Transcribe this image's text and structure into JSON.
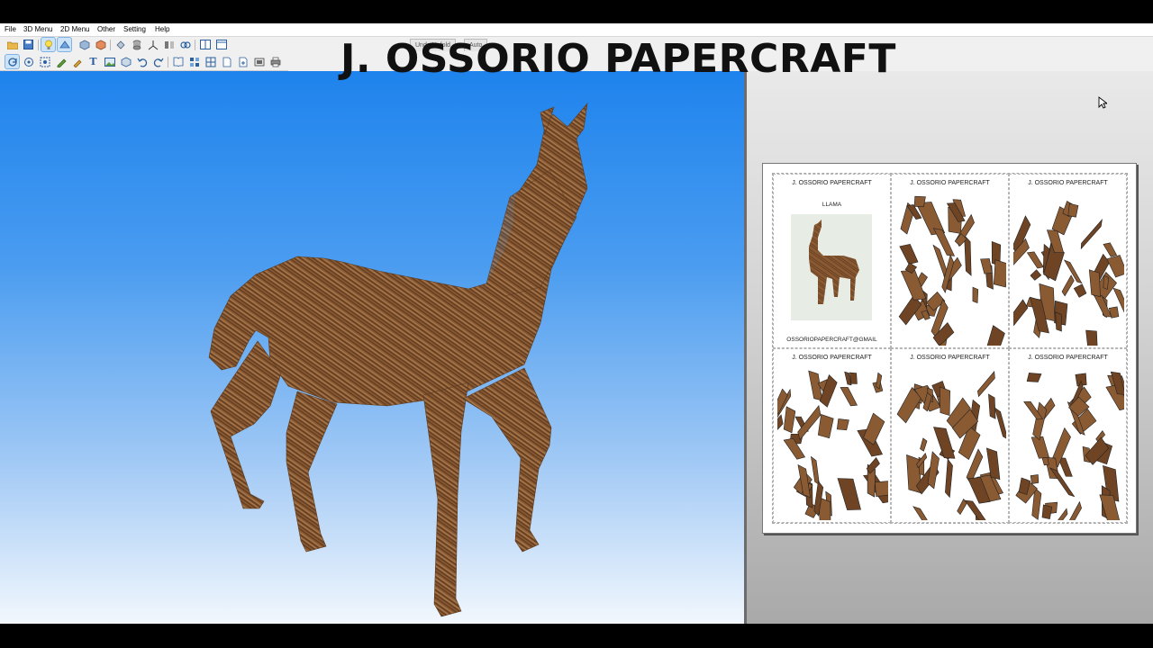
{
  "overlay": {
    "title": "J. OSSORIO PAPERCRAFT"
  },
  "menu": {
    "items": [
      {
        "label": "File"
      },
      {
        "label": "3D Menu"
      },
      {
        "label": "2D Menu"
      },
      {
        "label": "Other"
      },
      {
        "label": "Setting"
      },
      {
        "label": "Help"
      }
    ]
  },
  "toolbar": {
    "tabs": [
      {
        "label": "Undo Unfold"
      },
      {
        "label": "Auto"
      }
    ]
  },
  "sheet": {
    "cover": {
      "title": "J. OSSORIO PAPERCRAFT",
      "subtitle": "LLAMA",
      "email": "OSSORIOPAPERCRAFT@GMAIL"
    },
    "page_titles": [
      "J. OSSORIO PAPERCRAFT",
      "J. OSSORIO PAPERCRAFT",
      "J. OSSORIO PAPERCRAFT",
      "J. OSSORIO PAPERCRAFT",
      "J. OSSORIO PAPERCRAFT"
    ]
  },
  "colors": {
    "fur": "#8a5a33",
    "fur_dark": "#5e3a1e",
    "sky_top": "#1e83ed",
    "sky_bottom": "#f2f7fd",
    "panel_gray": "#bdbdbd"
  },
  "icons": [
    "open-folder-icon",
    "save-icon",
    "lightbulb-icon",
    "unfold-icon",
    "print-icon"
  ]
}
